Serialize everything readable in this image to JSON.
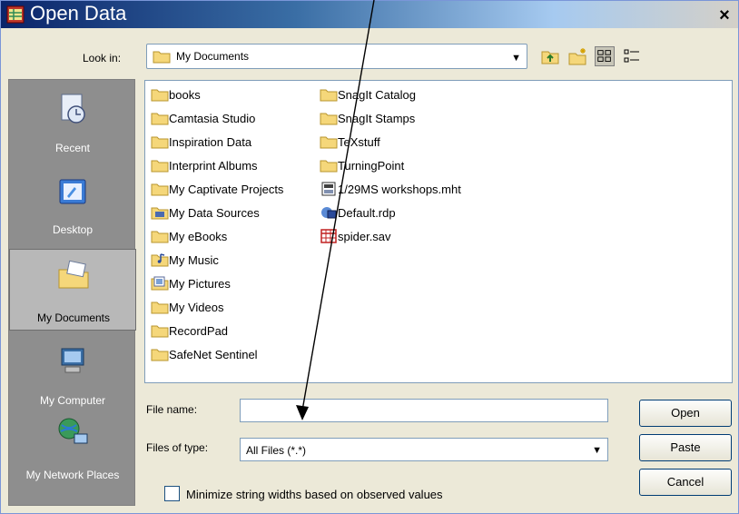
{
  "window": {
    "title": "Open Data",
    "close_glyph": "×"
  },
  "lookin": {
    "label": "Look in:",
    "value": "My Documents"
  },
  "toolbar": {
    "icons": [
      "up-folder-icon",
      "new-folder-icon",
      "list-view-icon",
      "details-view-icon"
    ]
  },
  "places": [
    {
      "label": "Recent",
      "icon": "recent-documents-icon"
    },
    {
      "label": "Desktop",
      "icon": "desktop-icon"
    },
    {
      "label": "My Documents",
      "icon": "my-documents-icon"
    },
    {
      "label": "My Computer",
      "icon": "my-computer-icon"
    },
    {
      "label": "My Network Places",
      "icon": "network-places-icon"
    }
  ],
  "files": {
    "column1": [
      {
        "name": "books",
        "icon": "folder-icon"
      },
      {
        "name": "Camtasia Studio",
        "icon": "folder-icon"
      },
      {
        "name": "Inspiration Data",
        "icon": "folder-icon"
      },
      {
        "name": "Interprint Albums",
        "icon": "folder-icon"
      },
      {
        "name": "My Captivate Projects",
        "icon": "folder-icon"
      },
      {
        "name": "My Data Sources",
        "icon": "data-sources-folder-icon"
      },
      {
        "name": "My eBooks",
        "icon": "folder-icon"
      },
      {
        "name": "My Music",
        "icon": "music-folder-icon"
      },
      {
        "name": "My Pictures",
        "icon": "pictures-folder-icon"
      },
      {
        "name": "My Videos",
        "icon": "folder-icon"
      },
      {
        "name": "RecordPad",
        "icon": "folder-icon"
      },
      {
        "name": "SafeNet Sentinel",
        "icon": "folder-icon"
      }
    ],
    "column2": [
      {
        "name": "SnagIt Catalog",
        "icon": "folder-icon"
      },
      {
        "name": "SnagIt Stamps",
        "icon": "folder-icon"
      },
      {
        "name": "TeXstuff",
        "icon": "folder-icon"
      },
      {
        "name": "TurningPoint",
        "icon": "folder-icon"
      },
      {
        "name": "1/29MS workshops.mht",
        "icon": "mht-file-icon"
      },
      {
        "name": "Default.rdp",
        "icon": "remote-desktop-file-icon"
      },
      {
        "name": "spider.sav",
        "icon": "spss-data-file-icon"
      }
    ]
  },
  "filename": {
    "label": "File name:",
    "value": ""
  },
  "filetype": {
    "label": "Files of type:",
    "value": "All Files (*.*)"
  },
  "buttons": {
    "open": "Open",
    "paste": "Paste",
    "cancel": "Cancel"
  },
  "checkbox": {
    "label": "Minimize string widths based on observed values",
    "checked": false
  },
  "colors": {
    "title_start": "#0a246a",
    "title_end": "#d4d0c8",
    "dialog_bg": "#ece9d8",
    "places_bg": "#8e8e8e",
    "folder": "#f5d77a",
    "arrow": "#000000"
  }
}
